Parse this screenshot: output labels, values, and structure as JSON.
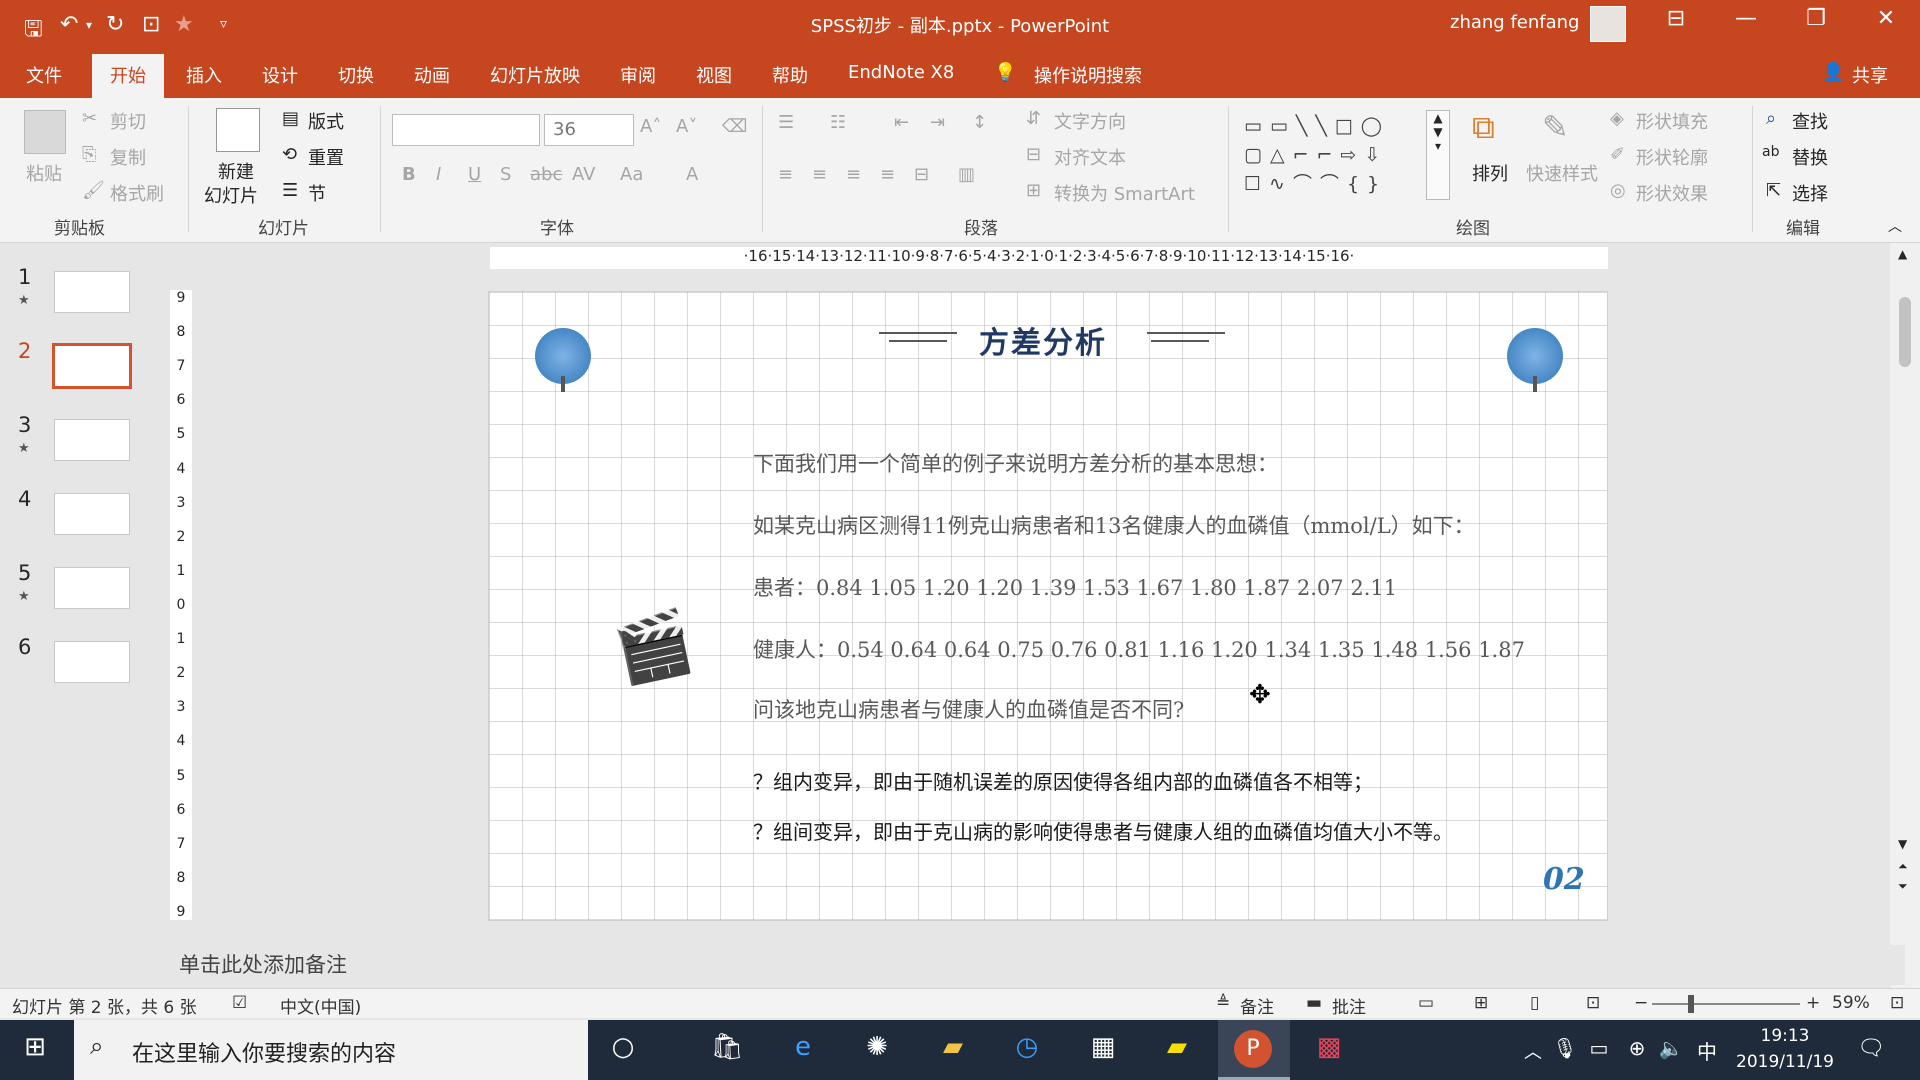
{
  "titlebar": {
    "document_title": "SPSS初步 - 副本.pptx  -  PowerPoint",
    "user_name": "zhang fenfang"
  },
  "tabs": [
    {
      "label": "文件"
    },
    {
      "label": "开始",
      "active": true
    },
    {
      "label": "插入"
    },
    {
      "label": "设计"
    },
    {
      "label": "切换"
    },
    {
      "label": "动画"
    },
    {
      "label": "幻灯片放映"
    },
    {
      "label": "审阅"
    },
    {
      "label": "视图"
    },
    {
      "label": "帮助"
    },
    {
      "label": "EndNote X8"
    },
    {
      "label": "操作说明搜索"
    }
  ],
  "share_label": "共享",
  "ribbon": {
    "clipboard": {
      "paste": "粘贴",
      "cut": "剪切",
      "copy": "复制",
      "format_painter": "格式刷",
      "group": "剪贴板"
    },
    "slides": {
      "new_slide_line1": "新建",
      "new_slide_line2": "幻灯片",
      "layout": "版式",
      "reset": "重置",
      "section": "节",
      "group": "幻灯片"
    },
    "font": {
      "font_name": "",
      "font_size": "36",
      "group": "字体"
    },
    "paragraph": {
      "text_direction": "文字方向",
      "align_text": "对齐文本",
      "smartart": "转换为 SmartArt",
      "group": "段落"
    },
    "drawing": {
      "arrange": "排列",
      "quick_styles": "快速样式",
      "shape_fill": "形状填充",
      "shape_outline": "形状轮廓",
      "shape_effects": "形状效果",
      "group": "绘图"
    },
    "editing": {
      "find": "查找",
      "replace": "替换",
      "select": "选择",
      "group": "编辑"
    }
  },
  "thumbnails": [
    {
      "num": "1",
      "star": true
    },
    {
      "num": "2",
      "selected": true
    },
    {
      "num": "3",
      "star": true
    },
    {
      "num": "4"
    },
    {
      "num": "5",
      "star": true
    },
    {
      "num": "6"
    }
  ],
  "ruler_h": "·16·15·14·13·12·11·10·9·8·7·6·5·4·3·2·1·0·1·2·3·4·5·6·7·8·9·10·11·12·13·14·15·16·",
  "ruler_v": [
    "9",
    "8",
    "7",
    "6",
    "5",
    "4",
    "3",
    "2",
    "1",
    "0",
    "1",
    "2",
    "3",
    "4",
    "5",
    "6",
    "7",
    "8",
    "9"
  ],
  "slide": {
    "title": "方差分析",
    "lines": [
      "下面我们用一个简单的例子来说明方差分析的基本思想：",
      "如某克山病区测得11例克山病患者和13名健康人的血磷值（mmol/L）如下：",
      "患者：0.84 1.05 1.20 1.20 1.39 1.53 1.67 1.80 1.87 2.07 2.11",
      "健康人：0.54 0.64 0.64 0.75 0.76 0.81 1.16 1.20 1.34 1.35 1.48 1.56 1.87",
      "问该地克山病患者与健康人的血磷值是否不同?",
      "？组内变异，即由于随机误差的原因使得各组内部的血磷值各不相等；",
      "？组间变异，即由于克山病的影响使得患者与健康人组的血磷值均值大小不等。"
    ],
    "page_number": "02",
    "colors": {
      "title": "#1f3864",
      "accent_blue": "#2e75b6"
    }
  },
  "notes_placeholder": "单击此处添加备注",
  "status": {
    "slide_info": "幻灯片 第 2 张，共 6 张",
    "language": "中文(中国)",
    "notes": "备注",
    "comments": "批注",
    "zoom": "59%"
  },
  "taskbar": {
    "search_placeholder": "在这里输入你要搜索的内容",
    "time": "19:13",
    "date": "2019/11/19",
    "ime": "中"
  },
  "colors": {
    "ribbon_brand": "#c6461f",
    "taskbar": "#1f2a3a"
  }
}
